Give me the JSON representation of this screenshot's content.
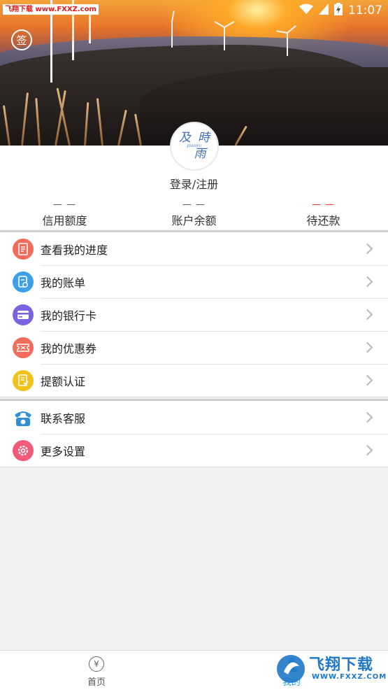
{
  "watermark_text": "飞翔下载 www.FXXZ.com",
  "status_bar": {
    "time": "11:07"
  },
  "header": {
    "sign_label": "签"
  },
  "profile": {
    "avatar_text": [
      "及",
      "時",
      "雨"
    ],
    "avatar_small": "JISHIYU",
    "login_label": "登录/注册"
  },
  "stats": [
    {
      "value": "— —",
      "label": "信用额度",
      "color": "#555555"
    },
    {
      "value": "— —",
      "label": "账户余额",
      "color": "#555555"
    },
    {
      "value": "— —",
      "label": "待还款",
      "color": "#e4342a"
    }
  ],
  "menu_group_1": [
    {
      "label": "查看我的进度",
      "icon": "progress-doc-icon",
      "color": "#f26b5b"
    },
    {
      "label": "我的账单",
      "icon": "bill-icon",
      "color": "#3fa0ea"
    },
    {
      "label": "我的银行卡",
      "icon": "bank-card-icon",
      "color": "#7a63e0"
    },
    {
      "label": "我的优惠券",
      "icon": "coupon-icon",
      "color": "#f26b5b"
    },
    {
      "label": "提额认证",
      "icon": "certification-icon",
      "color": "#f2c21b"
    }
  ],
  "menu_group_2": [
    {
      "label": "联系客服",
      "icon": "telephone-icon",
      "color": "#2f8fd8"
    },
    {
      "label": "更多设置",
      "icon": "settings-gear-icon",
      "color": "#f25a7a"
    }
  ],
  "tabbar": {
    "home_label": "首页",
    "home_icon_glyph": "¥",
    "mine_label": "我的",
    "active_color": "#2da2e8"
  },
  "corner_watermark": {
    "brand": "飞翔下载",
    "url": "WWW.FXXZ.COM"
  }
}
